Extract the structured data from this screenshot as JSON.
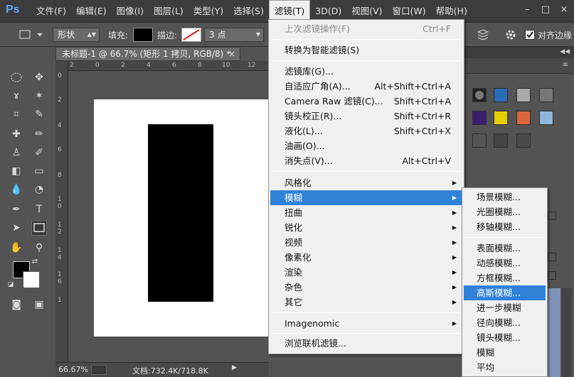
{
  "app": {
    "logo": "Ps"
  },
  "menubar": {
    "items": [
      "文件(F)",
      "编辑(E)",
      "图像(I)",
      "图层(L)",
      "类型(Y)",
      "选择(S)",
      "滤镜(T)",
      "3D(D)",
      "视图(V)",
      "窗口(W)",
      "帮助(H)"
    ],
    "active_index": 6,
    "window_buttons": [
      "–",
      "□",
      "×"
    ]
  },
  "options": {
    "shape_mode": "形状",
    "fill_label": "填充:",
    "stroke_label": "描边:",
    "stroke_width": "3 点",
    "align_edges_label": "对齐边缘"
  },
  "document": {
    "tab_title": "未标题-1 @ 66.7% (矩形 1 拷贝, RGB/8) *",
    "close_glyph": "×",
    "ruler_ticks_top": [
      "2",
      "0",
      "2",
      "4",
      "6",
      "8",
      "10",
      "12"
    ],
    "ruler_ticks_left": [
      "0",
      "2",
      "4",
      "6",
      "8",
      "1",
      "0",
      "1",
      "2",
      "1",
      "4",
      "1",
      "6",
      "1"
    ]
  },
  "status": {
    "zoom": "66.67%",
    "doc_size": "文档:732.4K/718.8K"
  },
  "filter_menu": {
    "items": [
      {
        "label": "上次滤镜操作(F)",
        "shortcut": "Ctrl+F",
        "disabled": true
      },
      {
        "label": "转换为智能滤镜(S)",
        "shortcut": ""
      },
      {
        "label": "滤镜库(G)...",
        "shortcut": ""
      },
      {
        "label": "自适应广角(A)...",
        "shortcut": "Alt+Shift+Ctrl+A"
      },
      {
        "label": "Camera Raw 滤镜(C)...",
        "shortcut": "Shift+Ctrl+A"
      },
      {
        "label": "镜头校正(R)...",
        "shortcut": "Shift+Ctrl+R"
      },
      {
        "label": "液化(L)...",
        "shortcut": "Shift+Ctrl+X"
      },
      {
        "label": "油画(O)...",
        "shortcut": ""
      },
      {
        "label": "消失点(V)...",
        "shortcut": "Alt+Ctrl+V"
      },
      {
        "label": "风格化",
        "submenu": true
      },
      {
        "label": "模糊",
        "submenu": true,
        "highlighted": true
      },
      {
        "label": "扭曲",
        "submenu": true
      },
      {
        "label": "锐化",
        "submenu": true
      },
      {
        "label": "视频",
        "submenu": true
      },
      {
        "label": "像素化",
        "submenu": true
      },
      {
        "label": "渲染",
        "submenu": true
      },
      {
        "label": "杂色",
        "submenu": true
      },
      {
        "label": "其它",
        "submenu": true
      },
      {
        "label": "Imagenomic",
        "submenu": true
      },
      {
        "label": "浏览联机滤镜...",
        "shortcut": ""
      }
    ],
    "arrow_glyph": "▶"
  },
  "blur_menu": {
    "items": [
      {
        "label": "场景模糊..."
      },
      {
        "label": "光圈模糊..."
      },
      {
        "label": "移轴模糊..."
      },
      {
        "label": "表面模糊..."
      },
      {
        "label": "动感模糊..."
      },
      {
        "label": "方框模糊..."
      },
      {
        "label": "高斯模糊...",
        "highlighted": true
      },
      {
        "label": "进一步模糊"
      },
      {
        "label": "径向模糊..."
      },
      {
        "label": "镜头模糊..."
      },
      {
        "label": "模糊"
      },
      {
        "label": "平均"
      }
    ]
  },
  "watermark": "Bai 经验",
  "colors": {
    "highlight": "#2f82d8",
    "menu_bg": "#f0f0f0",
    "app_bg": "#535353",
    "menubar_bg": "#3c3c3c"
  }
}
